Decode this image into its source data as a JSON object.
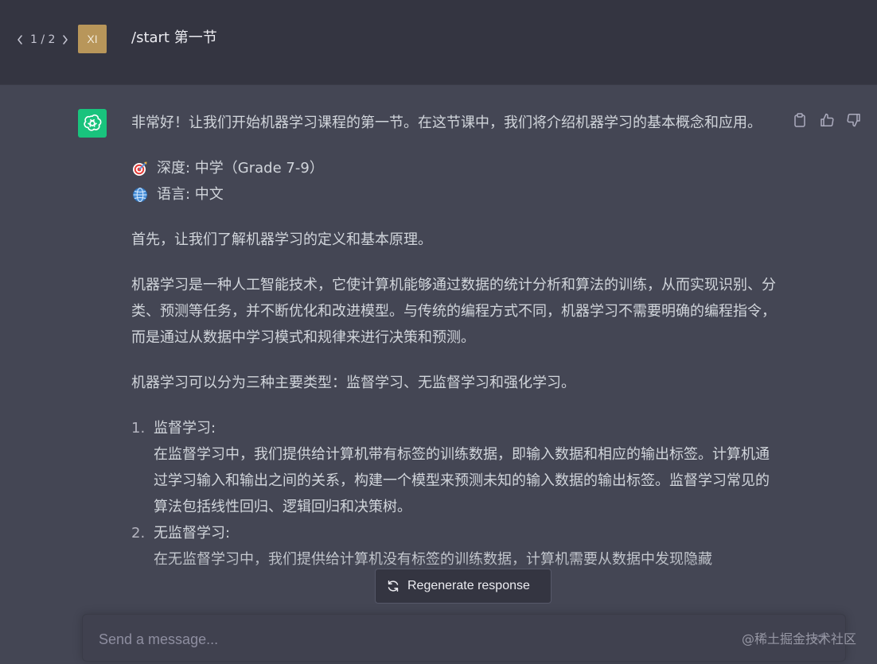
{
  "pager": {
    "count": "1 / 2"
  },
  "user": {
    "avatar_initials": "XI",
    "message": "/start 第一节"
  },
  "assistant": {
    "intro": "非常好！让我们开始机器学习课程的第一节。在这节课中，我们将介绍机器学习的基本概念和应用。",
    "depth_label": "深度: 中学（Grade 7-9）",
    "language_label": "语言: 中文",
    "para1": "首先，让我们了解机器学习的定义和基本原理。",
    "para2": "机器学习是一种人工智能技术，它使计算机能够通过数据的统计分析和算法的训练，从而实现识别、分类、预测等任务，并不断优化和改进模型。与传统的编程方式不同，机器学习不需要明确的编程指令，而是通过从数据中学习模式和规律来进行决策和预测。",
    "para3": "机器学习可以分为三种主要类型：监督学习、无监督学习和强化学习。",
    "list": [
      {
        "num": "1.",
        "title": "监督学习:",
        "body": "在监督学习中，我们提供给计算机带有标签的训练数据，即输入数据和相应的输出标签。计算机通过学习输入和输出之间的关系，构建一个模型来预测未知的输入数据的输出标签。监督学习常见的算法包括线性回归、逻辑回归和决策树。"
      },
      {
        "num": "2.",
        "title": "无监督学习:",
        "body": "在无监督学习中，我们提供给计算机没有标签的训练数据，计算机需要从数据中发现隐藏"
      }
    ]
  },
  "regenerate": {
    "label": "Regenerate response"
  },
  "composer": {
    "placeholder": "Send a message..."
  },
  "watermark": "@稀土掘金技术社区",
  "icons": {
    "prev": "chevron-left-icon",
    "next": "chevron-right-icon",
    "assistant_logo": "openai-logo-icon",
    "copy": "clipboard-icon",
    "like": "thumbs-up-icon",
    "dislike": "thumbs-down-icon",
    "depth": "dart-target-icon",
    "language": "globe-icon",
    "regenerate": "refresh-icon",
    "send": "send-icon"
  },
  "colors": {
    "page_bg": "#444654",
    "user_band_bg": "#343541",
    "user_avatar_bg": "#b8965a",
    "assistant_avatar_bg": "#19c37d",
    "composer_bg": "#40414f"
  }
}
